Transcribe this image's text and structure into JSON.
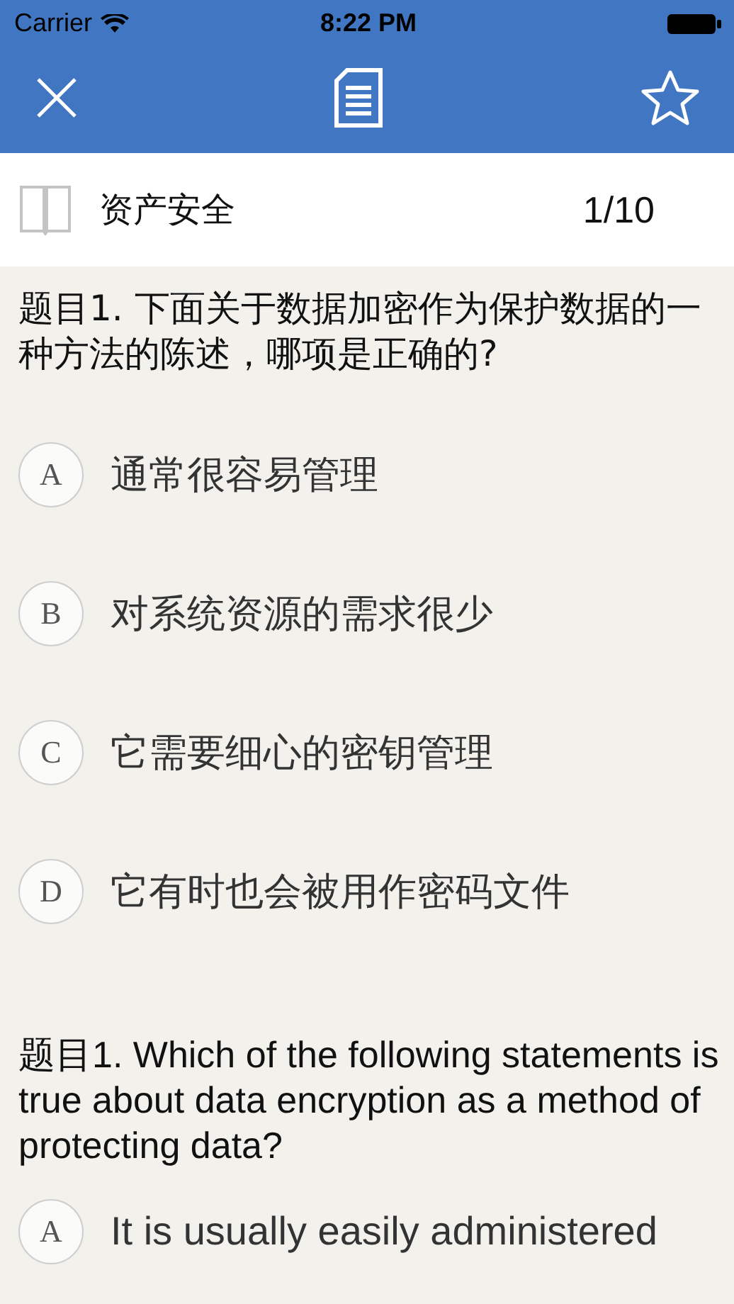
{
  "status_bar": {
    "carrier": "Carrier",
    "time": "8:22 PM"
  },
  "header": {
    "category": "资产安全",
    "progress": "1/10"
  },
  "questions": [
    {
      "text": "题目1. 下面关于数据加密作为保护数据的一种方法的陈述，哪项是正确的?",
      "kind": "chinese",
      "options": [
        {
          "letter": "A",
          "text": "通常很容易管理",
          "selected": false
        },
        {
          "letter": "B",
          "text": "对系统资源的需求很少",
          "selected": false
        },
        {
          "letter": "C",
          "text": "它需要细心的密钥管理",
          "selected": false
        },
        {
          "letter": "D",
          "text": "它有时也会被用作密码文件",
          "selected": false
        }
      ]
    },
    {
      "text": "题目1. Which of the following statements is true about data encryption as a method of protecting data?",
      "kind": "english",
      "options": [
        {
          "letter": "A",
          "text": "It is usually easily administered",
          "selected": false
        }
      ]
    }
  ]
}
